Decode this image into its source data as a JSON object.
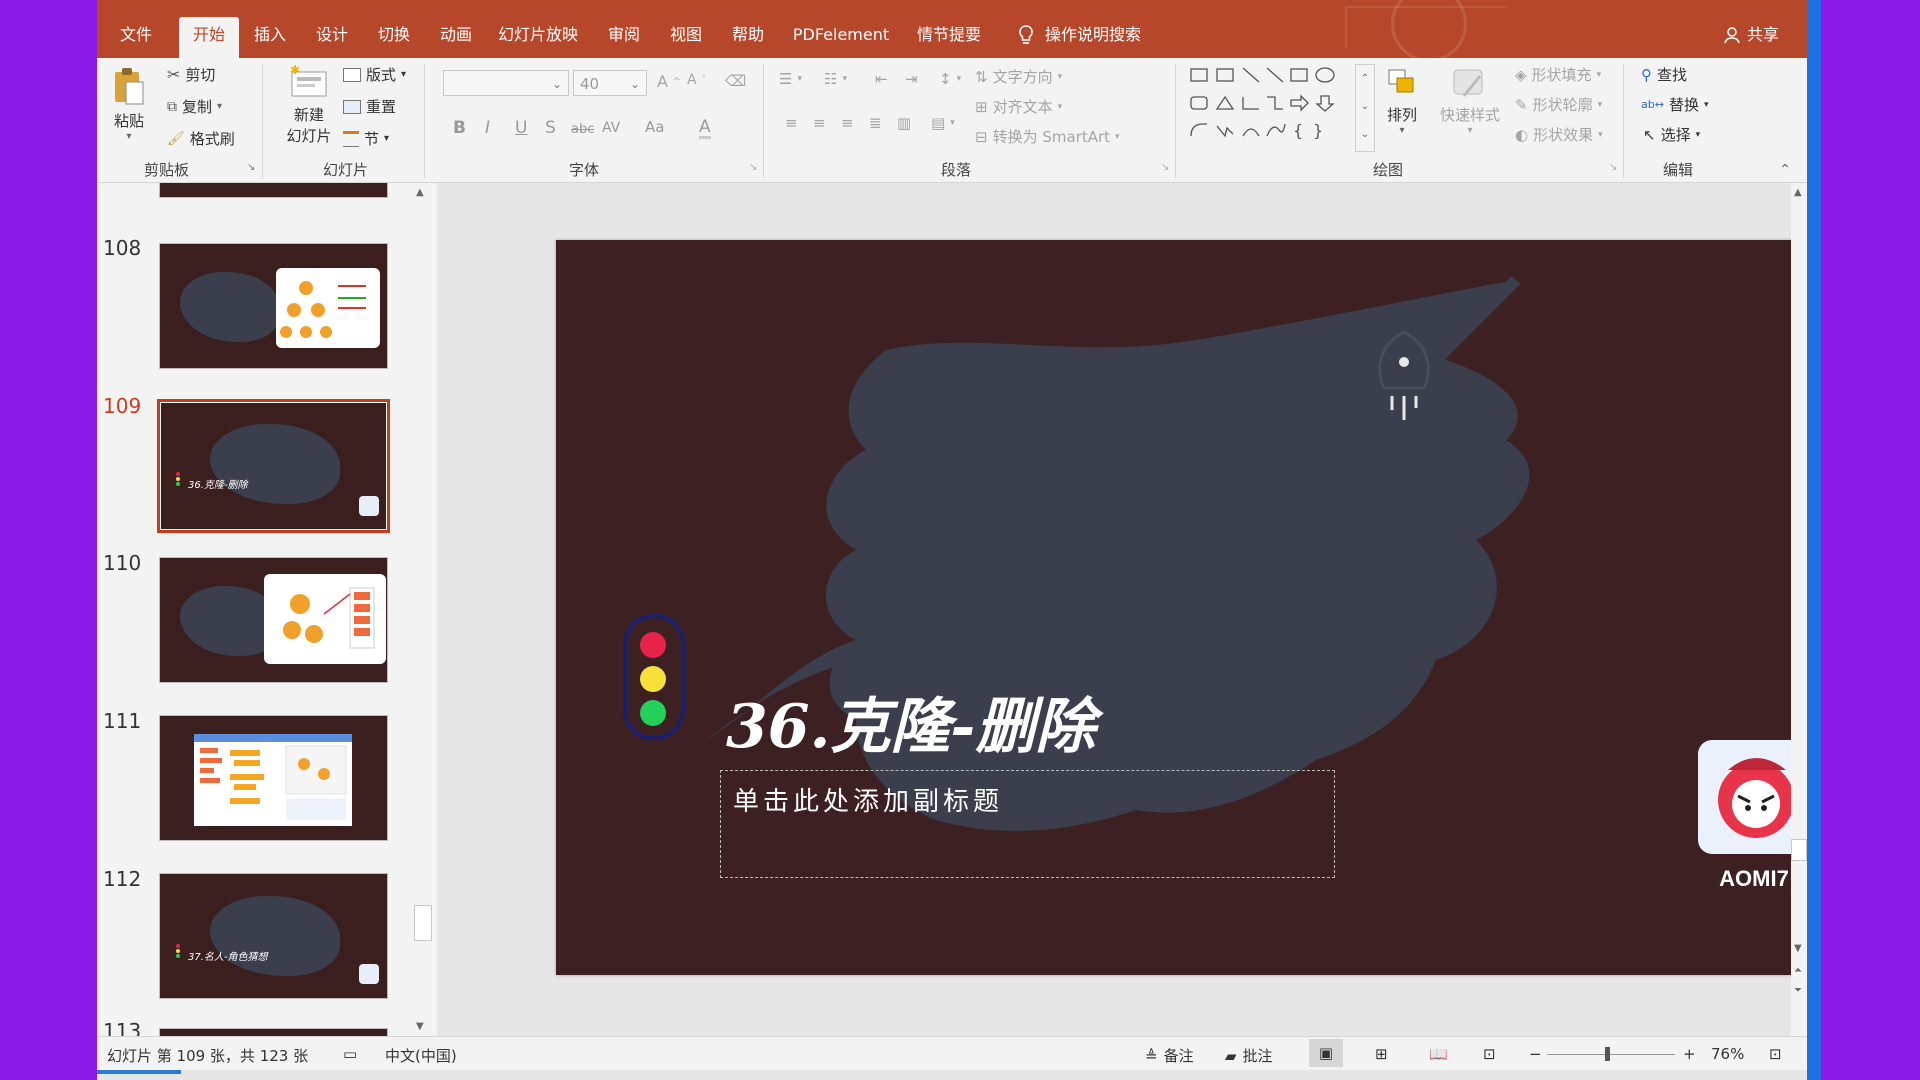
{
  "colors": {
    "accent": "#B7472A",
    "slide_bg": "#3D2122",
    "brush": "#3B3E4D",
    "light_red": "#E8234A",
    "light_yellow": "#F7E03A",
    "light_green": "#22D05A",
    "desktop": "#8B19E8"
  },
  "tabs": [
    {
      "label": "文件",
      "active": false
    },
    {
      "label": "开始",
      "active": true
    },
    {
      "label": "插入",
      "active": false
    },
    {
      "label": "设计",
      "active": false
    },
    {
      "label": "切换",
      "active": false
    },
    {
      "label": "动画",
      "active": false
    },
    {
      "label": "幻灯片放映",
      "active": false
    },
    {
      "label": "审阅",
      "active": false
    },
    {
      "label": "视图",
      "active": false
    },
    {
      "label": "帮助",
      "active": false
    },
    {
      "label": "PDFelement",
      "active": false
    },
    {
      "label": "情节提要",
      "active": false
    }
  ],
  "tell_me": "操作说明搜索",
  "share_label": "共享",
  "ribbon": {
    "clipboard": {
      "paste": "粘贴",
      "cut": "剪切",
      "copy": "复制",
      "format_painter": "格式刷",
      "label": "剪贴板"
    },
    "slides": {
      "new_slide_1": "新建",
      "new_slide_2": "幻灯片",
      "layout": "版式",
      "reset": "重置",
      "section": "节",
      "label": "幻灯片"
    },
    "font": {
      "size": "40",
      "label": "字体",
      "buttons": [
        "B",
        "I",
        "U",
        "S",
        "abc",
        "AV",
        "Aa",
        "A"
      ]
    },
    "paragraph": {
      "text_direction": "文字方向",
      "align_text": "对齐文本",
      "smartart": "转换为 SmartArt",
      "label": "段落"
    },
    "drawing": {
      "arrange": "排列",
      "quick_styles": "快速样式",
      "shape_fill": "形状填充",
      "shape_outline": "形状轮廓",
      "shape_effects": "形状效果",
      "label": "绘图"
    },
    "editing": {
      "find": "查找",
      "replace": "替换",
      "select": "选择",
      "label": "编辑"
    }
  },
  "thumbnails": [
    {
      "num": "108",
      "caption": "",
      "kind": "image"
    },
    {
      "num": "109",
      "caption": "36.克隆-删除",
      "kind": "title",
      "selected": true
    },
    {
      "num": "110",
      "caption": "",
      "kind": "image2"
    },
    {
      "num": "111",
      "caption": "",
      "kind": "screenshot"
    },
    {
      "num": "112",
      "caption": "37.名人-角色猜想",
      "kind": "title"
    },
    {
      "num": "113",
      "caption": "",
      "kind": "partial"
    }
  ],
  "slide": {
    "title": "36.克隆-删除",
    "subtitle_placeholder": "单击此处添加副标题",
    "logo_text": "AOMI7"
  },
  "status": {
    "slide_info": "幻灯片 第 109 张，共 123 张",
    "language": "中文(中国)",
    "notes": "备注",
    "comments": "批注",
    "zoom": "76%"
  }
}
